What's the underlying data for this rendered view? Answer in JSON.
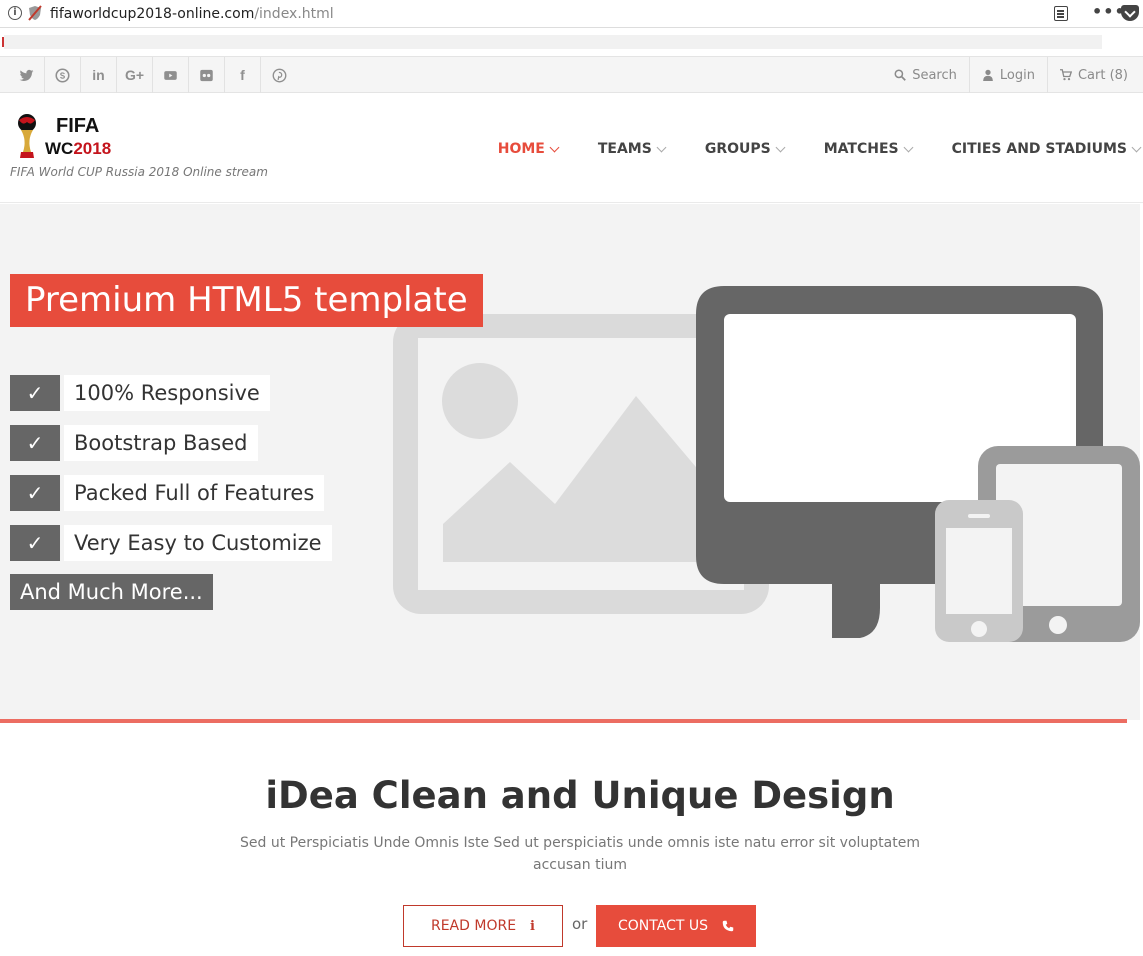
{
  "browser": {
    "url_host": "fifaworldcup2018-online.com",
    "url_path": "/index.html",
    "icons": [
      "info-icon",
      "shield-icon",
      "reader-view-icon",
      "more-icon",
      "pocket-icon"
    ]
  },
  "topbar": {
    "social": [
      {
        "name": "twitter-icon"
      },
      {
        "name": "skype-icon"
      },
      {
        "name": "linkedin-icon",
        "glyph": "in"
      },
      {
        "name": "google-plus-icon",
        "glyph": "G+"
      },
      {
        "name": "youtube-icon"
      },
      {
        "name": "flickr-icon"
      },
      {
        "name": "facebook-icon",
        "glyph": "f"
      },
      {
        "name": "pinterest-icon"
      }
    ],
    "search_label": "Search",
    "login_label": "Login",
    "cart_label": "Cart (8)"
  },
  "header": {
    "logo_line1": "FIFA",
    "logo_line2_a": "WC",
    "logo_line2_b": "2018",
    "tagline": "FIFA World CUP Russia 2018 Online stream",
    "nav": [
      {
        "label": "HOME",
        "active": true
      },
      {
        "label": "TEAMS"
      },
      {
        "label": "GROUPS"
      },
      {
        "label": "MATCHES"
      },
      {
        "label": "CITIES AND STADIUMS"
      }
    ]
  },
  "hero": {
    "title": "Premium HTML5 template",
    "check_glyph": "✓",
    "features": [
      "100% Responsive",
      "Bootstrap Based",
      "Packed Full of Features",
      "Very Easy to Customize"
    ],
    "more": "And Much More..."
  },
  "intro": {
    "title": "iDea Clean and Unique Design",
    "text": "Sed ut Perspiciatis Unde Omnis Iste Sed ut perspiciatis unde omnis iste natu error sit voluptatem accusan tium",
    "read_more": "READ MORE",
    "or": "or",
    "contact": "CONTACT US"
  },
  "colors": {
    "accent": "#e74c3c",
    "dark_gray": "#666666",
    "hero_bg": "#f3f3f3"
  }
}
